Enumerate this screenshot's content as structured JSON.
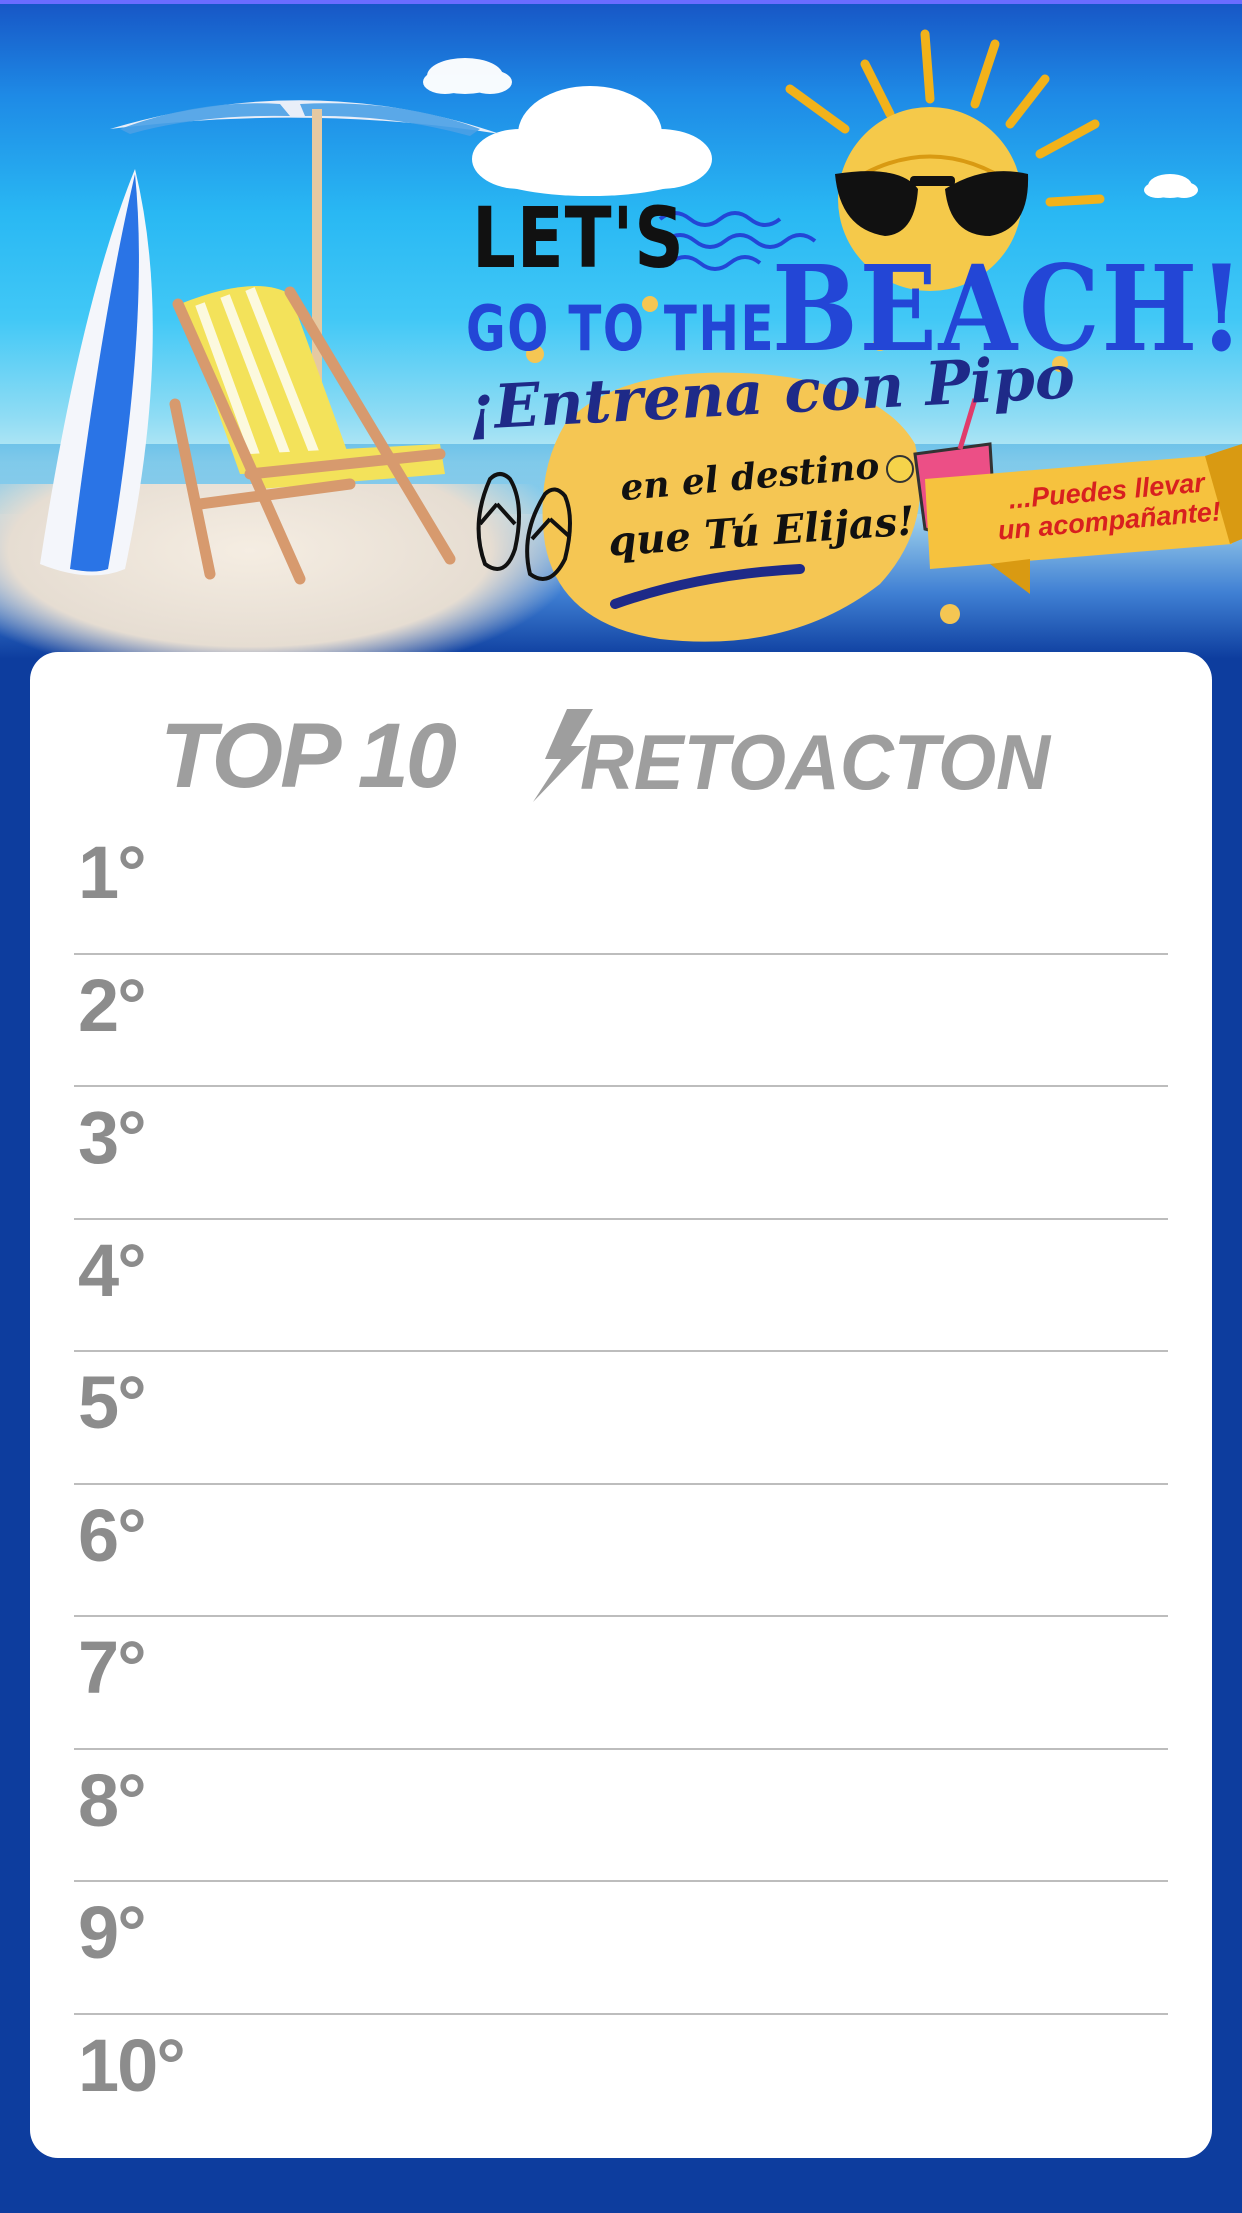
{
  "banner": {
    "headline_lets": "LET'S",
    "headline_go_to_the": "GO TO THE",
    "headline_beach": "BEACH!",
    "subtitle": "¡Entrena con Pipo",
    "tagline_line1": "en el destino",
    "tagline_line2": "que Tú Elijas!",
    "ribbon_text": "...Puedes llevar un acompañante!"
  },
  "leaderboard": {
    "title": "TOP 10",
    "brand": "RETOACTON",
    "ranks": [
      "1°",
      "2°",
      "3°",
      "4°",
      "5°",
      "6°",
      "7°",
      "8°",
      "9°",
      "10°"
    ]
  },
  "colors": {
    "background_blue": "#0d3d9e",
    "headline_blue": "#2346d6",
    "rank_gray": "#8c8c8c",
    "ribbon_yellow": "#f6c23e",
    "ribbon_text_red": "#d8201f"
  }
}
